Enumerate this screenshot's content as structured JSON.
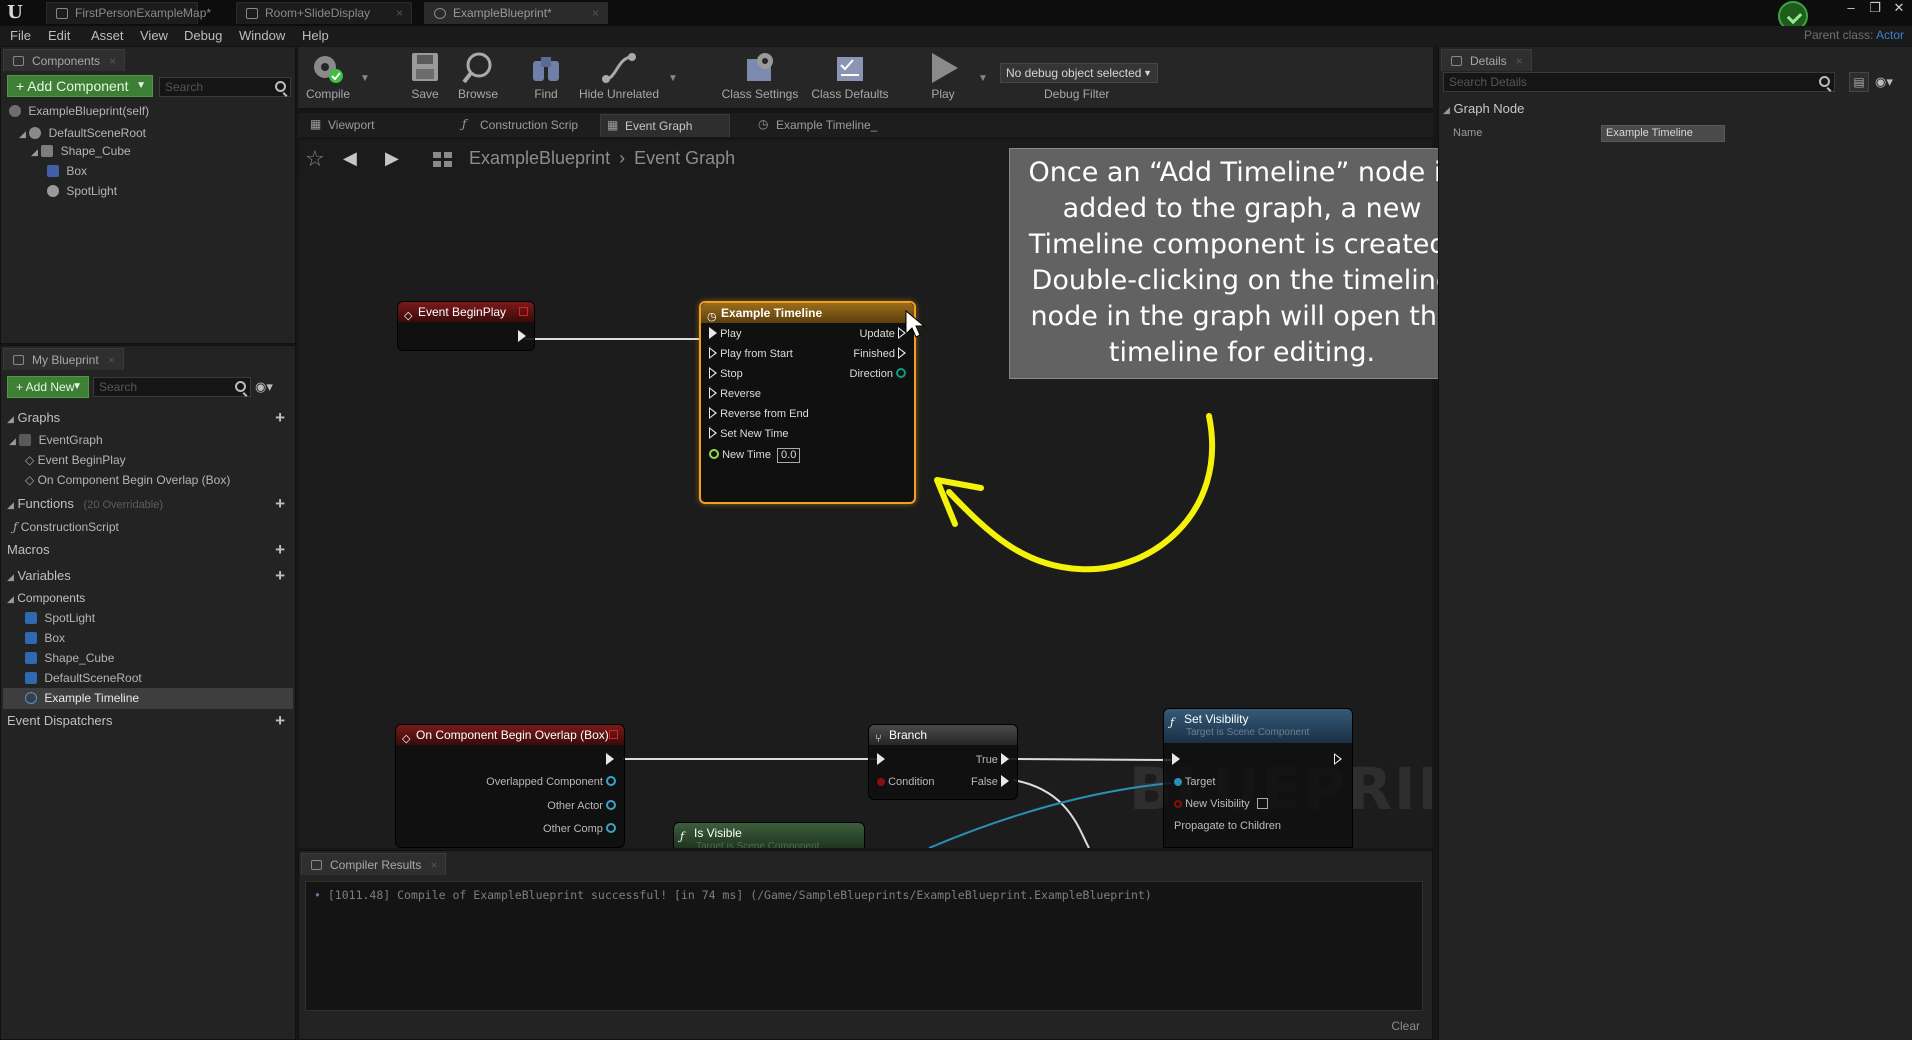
{
  "title_bar": {
    "tabs": [
      "FirstPersonExampleMap*",
      "Room+SlideDisplay",
      "ExampleBlueprint*"
    ]
  },
  "menu": {
    "items": [
      "File",
      "Edit",
      "Asset",
      "View",
      "Debug",
      "Window",
      "Help"
    ],
    "parent_class_label": "Parent class:",
    "parent_class_value": "Actor"
  },
  "components_panel": {
    "tab": "Components",
    "add_button": "+ Add Component",
    "search_placeholder": "Search",
    "self_item": "ExampleBlueprint(self)",
    "tree": [
      "DefaultSceneRoot",
      "Shape_Cube",
      "Box",
      "SpotLight"
    ]
  },
  "my_blueprint": {
    "tab": "My Blueprint",
    "add_button": "+ Add New",
    "search_placeholder": "Search",
    "graphs_header": "Graphs",
    "graphs": [
      "EventGraph",
      "Event BeginPlay",
      "On Component Begin Overlap (Box)"
    ],
    "functions_header": "Functions",
    "functions_sub": "(20 Overridable)",
    "functions": [
      "ConstructionScript"
    ],
    "macros_header": "Macros",
    "variables_header": "Variables",
    "components_header": "Components",
    "components": [
      "SpotLight",
      "Box",
      "Shape_Cube",
      "DefaultSceneRoot",
      "Example Timeline"
    ],
    "dispatchers_header": "Event Dispatchers"
  },
  "toolbar": {
    "buttons": [
      "Compile",
      "Save",
      "Browse",
      "Find",
      "Hide Unrelated",
      "Class Settings",
      "Class Defaults",
      "Play"
    ],
    "debug_select": "No debug object selected",
    "debug_filter": "Debug Filter"
  },
  "editor_tabs": [
    "Viewport",
    "Construction Scrip",
    "Event Graph",
    "Example Timeline_"
  ],
  "graph": {
    "breadcrumb_root": "ExampleBlueprint",
    "breadcrumb_current": "Event Graph",
    "watermark": "BLUEPRINT",
    "event_begin_play": "Event BeginPlay",
    "timeline_node": {
      "title": "Example Timeline",
      "inputs": [
        "Play",
        "Play from Start",
        "Stop",
        "Reverse",
        "Reverse from End",
        "Set New Time"
      ],
      "new_time_label": "New Time",
      "new_time_value": "0.0",
      "outputs": [
        "Update",
        "Finished",
        "Direction"
      ]
    },
    "overlap_node": {
      "title": "On Component Begin Overlap (Box)",
      "pins": [
        "Overlapped Component",
        "Other Actor",
        "Other Comp"
      ]
    },
    "branch_node": {
      "title": "Branch",
      "condition": "Condition",
      "true_label": "True",
      "false_label": "False"
    },
    "set_visibility_node": {
      "title": "Set Visibility",
      "subtitle": "Target is Scene Component",
      "target": "Target",
      "new_visibility": "New Visibility",
      "propagate": "Propagate to Children"
    },
    "is_visible_node": {
      "title": "Is Visible",
      "subtitle": "Target is Scene Component"
    },
    "annotation": "Once an “Add Timeline” node is added to the graph, a new Timeline component is created. Double-clicking on the timeline node in the graph will open the timeline for editing."
  },
  "compiler": {
    "tab": "Compiler Results",
    "log_line": "[1011.48] Compile of ExampleBlueprint successful! [in 74 ms] (/Game/SampleBlueprints/ExampleBlueprint.ExampleBlueprint)",
    "clear": "Clear"
  },
  "details": {
    "tab": "Details",
    "search_placeholder": "Search Details",
    "category": "Graph Node",
    "name_label": "Name",
    "name_value": "Example Timeline"
  },
  "colors": {
    "accent_green": "#3d7f34",
    "timeline_outline": "#f0a020",
    "arrow_yellow": "#f5f20a",
    "event_red": "#8b1a1a",
    "blue_link": "#3a7fd0"
  }
}
